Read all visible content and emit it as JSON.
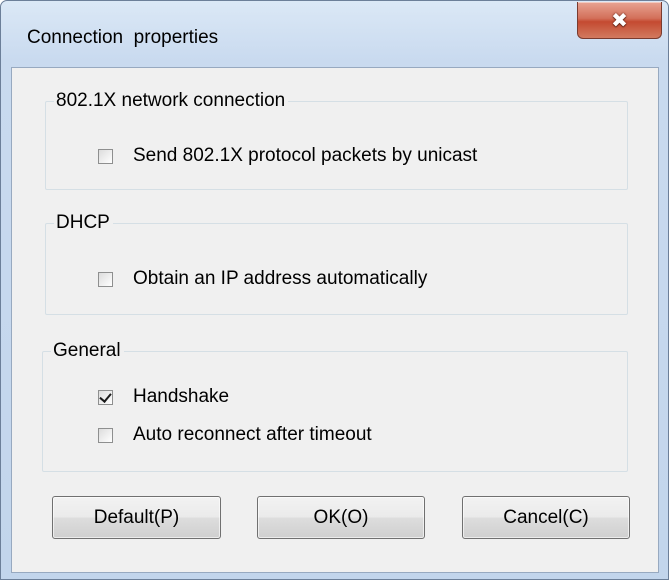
{
  "window": {
    "title": "Connection  properties",
    "close_symbol": "✖"
  },
  "groups": {
    "dot1x": {
      "title": "802.1X network connection",
      "options": [
        {
          "label": "Send 802.1X protocol packets by unicast",
          "checked": false
        }
      ]
    },
    "dhcp": {
      "title": "DHCP",
      "options": [
        {
          "label": "Obtain an IP address automatically",
          "checked": false
        }
      ]
    },
    "general": {
      "title": "General",
      "options": [
        {
          "label": "Handshake",
          "checked": true
        },
        {
          "label": "Auto reconnect after timeout",
          "checked": false
        }
      ]
    }
  },
  "buttons": {
    "default_label": "Default(P)",
    "ok_label": "OK(O)",
    "cancel_label": "Cancel(C)"
  },
  "icons": {
    "close": "close-icon",
    "checkbox_checked": "checkmark-icon"
  },
  "colors": {
    "close_button": "#c44a31",
    "frame": "#c9daef",
    "dialog_face": "#f0f0f0"
  }
}
